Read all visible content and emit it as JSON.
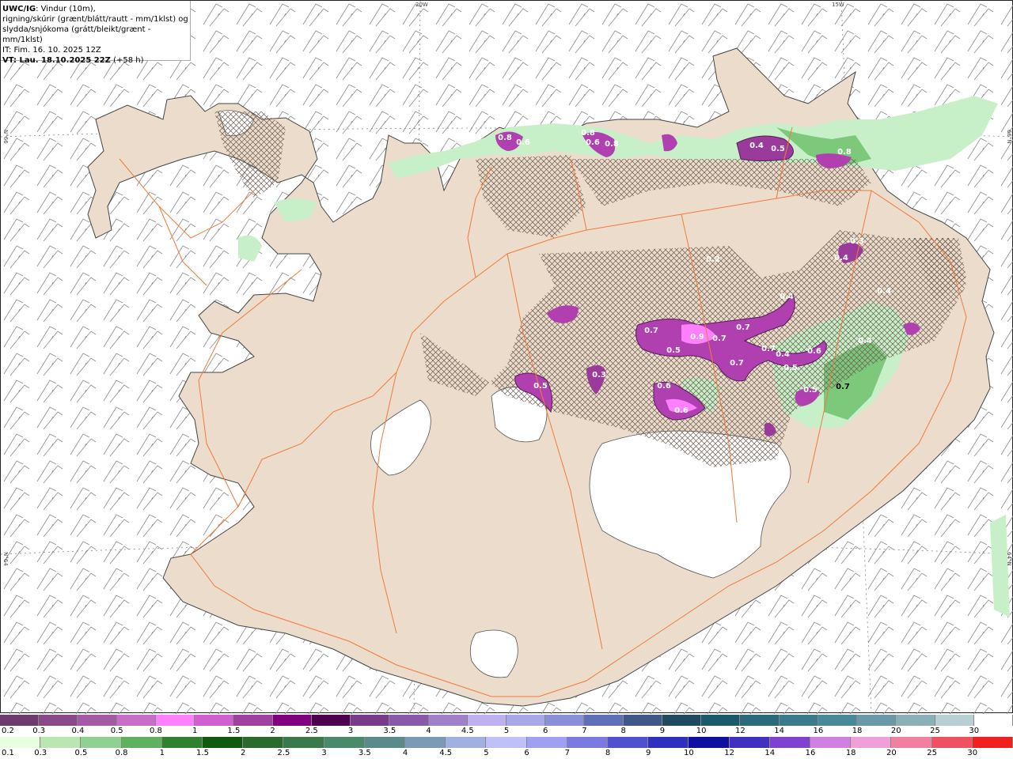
{
  "info": {
    "model": "UWC/IG",
    "line1": ": Vindur (10m),",
    "line2": "rigning/skúrir (grænt/blátt/rautt - mm/1klst) og",
    "line3": "slydda/snjókoma (grátt/bleikt/grænt - mm/1klst)",
    "it": "IT: Fim. 16. 10. 2025 12Z",
    "vt_label": "VT: Lau. 18.10.2025 22Z",
    "vt_offset": " (+58 h)"
  },
  "grid_labels": {
    "lon_20w": "20W",
    "lon_15w": "15W",
    "lat_66n_left": "N°66",
    "lat_66n_right": "66°N",
    "lat_64n_left": "N°64",
    "lat_64n_right": "64°N"
  },
  "colors": {
    "land": "#ecdccb",
    "glacier": "#ffffff",
    "roads": "#f07a3a",
    "coast": "#555555",
    "rain_light": "#c8f0c8",
    "rain_mid": "#7cc97c",
    "snow_purple": "#b040b0",
    "snow_dark": "#6a2a6a"
  },
  "snow_values": [
    {
      "label": "0.8"
    },
    {
      "label": "0.6"
    },
    {
      "label": "0.8"
    },
    {
      "label": "0.6"
    },
    {
      "label": "0.8"
    },
    {
      "label": "0.4"
    },
    {
      "label": "0.5"
    },
    {
      "label": "0.8"
    },
    {
      "label": "0.2"
    },
    {
      "label": "0.3"
    },
    {
      "label": "0.4"
    },
    {
      "label": "0.4"
    },
    {
      "label": "0.7"
    },
    {
      "label": "0.5"
    },
    {
      "label": "0.9"
    },
    {
      "label": "0.7"
    },
    {
      "label": "0.7"
    },
    {
      "label": "0.7"
    },
    {
      "label": "0.4"
    },
    {
      "label": "0.5"
    },
    {
      "label": "0.6"
    },
    {
      "label": "0.7"
    },
    {
      "label": "0.3"
    },
    {
      "label": "0.5"
    },
    {
      "label": "0.6"
    },
    {
      "label": "0.6"
    },
    {
      "label": "0.5"
    },
    {
      "label": "0.7"
    },
    {
      "label": "0.4"
    },
    {
      "label": "0.4"
    }
  ],
  "legend_snow": {
    "labels": [
      "0.2",
      "0.3",
      "0.4",
      "0.5",
      "0.8",
      "1",
      "1.5",
      "2",
      "2.5",
      "3",
      "3.5",
      "4",
      "4.5",
      "5",
      "6",
      "7",
      "8",
      "9",
      "10",
      "12",
      "14",
      "16",
      "18",
      "20",
      "25",
      "30"
    ],
    "colors": [
      "#6e3b6e",
      "#8a4a8a",
      "#a45aa4",
      "#c86ec8",
      "#ff80ff",
      "#d060d0",
      "#a040a0",
      "#800080",
      "#4d004d",
      "#7a3a8a",
      "#8a5aaa",
      "#a080c8",
      "#c0b0f0",
      "#a8a8e8",
      "#8a90d8",
      "#6070b8",
      "#405888",
      "#204a60",
      "#1a5a6a",
      "#2a6a7a",
      "#3a7a8a",
      "#4a8a98",
      "#6a9aa8",
      "#8ab0b8",
      "#b8d0d4",
      "#ffffff"
    ]
  },
  "legend_rain": {
    "labels": [
      "0.1",
      "0.3",
      "0.5",
      "0.8",
      "1",
      "1.5",
      "2",
      "2.5",
      "3",
      "3.5",
      "4",
      "4.5",
      "5",
      "6",
      "7",
      "8",
      "9",
      "10",
      "12",
      "14",
      "16",
      "18",
      "20",
      "25",
      "30"
    ],
    "colors": [
      "#e8ffe0",
      "#b8e8b0",
      "#90d090",
      "#60b060",
      "#308030",
      "#105a10",
      "#2a6a2a",
      "#3a7a4a",
      "#4a8a6a",
      "#5a8a8a",
      "#7a9ab8",
      "#a0b0e0",
      "#c0c0f8",
      "#a0a0f0",
      "#7a7ae0",
      "#5050d0",
      "#3030c0",
      "#1010a0",
      "#4030c0",
      "#8040d0",
      "#d080e0",
      "#f0a0d8",
      "#f080a0",
      "#f05060",
      "#f02020"
    ]
  }
}
